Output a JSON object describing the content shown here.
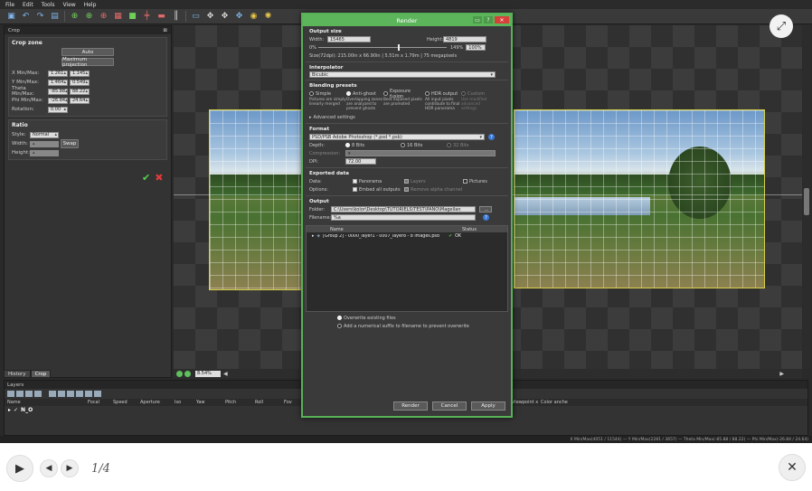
{
  "menu": [
    "File",
    "Edit",
    "Tools",
    "View",
    "Help"
  ],
  "crop_panel": {
    "title": "Crop",
    "section": "Crop zone",
    "auto_btn": "Auto",
    "max_proj_btn": "Maximum projection",
    "fields": [
      {
        "label": "X Min/Max:",
        "a": "1.261",
        "b": "1.145"
      },
      {
        "label": "Y Min/Max:",
        "a": "1.464",
        "b": "0.549"
      },
      {
        "label": "Theta Min/Max:",
        "a": "-85.88",
        "b": "88.22"
      },
      {
        "label": "Phi Min/Max:",
        "a": "-26.84",
        "b": "24.64"
      },
      {
        "label": "Rotation:",
        "a": "0.00",
        "b": ""
      }
    ],
    "ratio_title": "Ratio",
    "style_label": "Style:",
    "style_value": "Normal",
    "width_label": "Width:",
    "height_label": "Height:",
    "swap_btn": "Swap",
    "tabs": [
      "History",
      "Crop"
    ]
  },
  "canvas": {
    "zoom": "8.54%"
  },
  "layers": {
    "title": "Layers",
    "columns": [
      "Name",
      "Focal",
      "Speed",
      "Aperture",
      "Iso",
      "Yaw",
      "Pitch",
      "Roll",
      "Fov",
      "Viewpoint x",
      "Color anche"
    ],
    "row": "N_O"
  },
  "status_text": "X Min/Max(4051 / 11544) — Y Min/Max(2281 / 3657) — Theta Min/Max(-85.88 / 88.22) — Phi Min/Max(-26.84 / 24.64)",
  "dialog": {
    "title": "Render",
    "output_size": {
      "title": "Output size",
      "width_label": "Width:",
      "width_value": "15465",
      "height_label": "Height:",
      "height_value": "4819",
      "pct_label": "0%",
      "pct_right": "149%",
      "pct_box": "100%",
      "size_info": "Size(72dpi): 215.00in x 66.90in | 5.51m x 1.79m | 75 megapixels"
    },
    "interpolator": {
      "title": "Interpolator",
      "value": "Bicubic"
    },
    "blending": {
      "title": "Blending presets",
      "options": [
        {
          "label": "Simple",
          "desc": "Pictures are simply linearly merged",
          "on": false
        },
        {
          "label": "Anti-ghost",
          "desc": "Overlapping zones are analyzed to prevent ghosts",
          "on": true
        },
        {
          "label": "Exposure fusion",
          "desc": "Best exposed pixels are promoted",
          "on": false
        },
        {
          "label": "HDR output",
          "desc": "All input pixels contribute to final HDR panorama",
          "on": false
        },
        {
          "label": "Custom",
          "desc": "Use modified advanced settings",
          "on": false
        }
      ],
      "advanced": "Advanced settings"
    },
    "format": {
      "title": "Format",
      "value": "PSD/PSB Adobe Photoshop (*.psd *.psb)",
      "depth_label": "Depth:",
      "depths": [
        "8 Bits",
        "16 Bits",
        "32 Bits"
      ],
      "compression_label": "Compression:",
      "dpi_label": "DPI:",
      "dpi_value": "72.00"
    },
    "exported": {
      "title": "Exported data",
      "data_label": "Data:",
      "options_label": "Options:",
      "panorama": "Panorama",
      "layers": "Layers",
      "pictures": "Pictures",
      "embed": "Embed all outputs",
      "remove_alpha": "Remove alpha channel"
    },
    "output": {
      "title": "Output",
      "folder_label": "Folder:",
      "folder_value": "C:\\Users\\kolor\\Desktop\\TUTORIELS\\TEST\\PANO\\Magellan",
      "browse": "...",
      "filename_label": "Filename:",
      "filename_value": "%a",
      "col_name": "Name",
      "col_status": "Status",
      "item_name": "[Group 2] - 0000_layer1 - 0007_layer8 - 8 images.psd",
      "item_status": "OK",
      "overwrite": "Overwrite existing files",
      "add_suffix": "Add a numerical suffix to filename to prevent overwrite"
    },
    "buttons": {
      "render": "Render",
      "cancel": "Cancel",
      "apply": "Apply"
    }
  },
  "player": {
    "counter": "1/4"
  }
}
